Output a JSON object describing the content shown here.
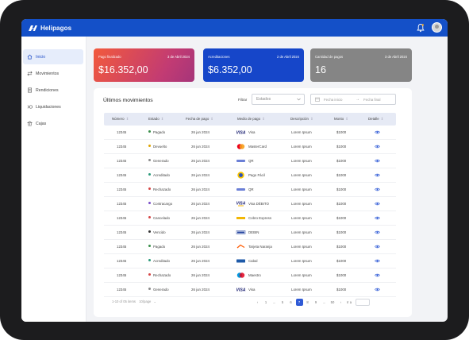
{
  "app": {
    "name": "Helipagos"
  },
  "sidebar": {
    "items": [
      {
        "label": "Inicio",
        "active": true
      },
      {
        "label": "Movimientos"
      },
      {
        "label": "Rendiciones"
      },
      {
        "label": "Liquidaciones"
      },
      {
        "label": "Cajas"
      }
    ]
  },
  "cards": [
    {
      "label": "Pago finalizado",
      "date": "3 de Abril 2024",
      "amount": "$16.352,00"
    },
    {
      "label": "Acreditaciones",
      "date": "2 de Abril 2024",
      "amount": "$6.352,00"
    },
    {
      "label": "Cantidad de pagos",
      "date": "3 de Abril 2024",
      "amount": "16"
    }
  ],
  "movements": {
    "title": "Últimos movimientos",
    "filter_label": "Filtrar",
    "estado_placeholder": "Estados",
    "date_start_placeholder": "Fecha inicio",
    "date_end_placeholder": "Fecha final",
    "columns": [
      "Número",
      "Estado",
      "Fecha de pago",
      "Medio de pago",
      "Descripción",
      "Monto",
      "Detalle"
    ],
    "rows": [
      {
        "numero": "12345",
        "estado": "Pagado",
        "fecha": "26 jun 2024",
        "medio": "Visa",
        "descripcion": "Lorem Ipsum",
        "monto": "$1000"
      },
      {
        "numero": "12345",
        "estado": "Devuelto",
        "fecha": "26 jun 2024",
        "medio": "MasterCard",
        "descripcion": "Lorem Ipsum",
        "monto": "$1000"
      },
      {
        "numero": "12345",
        "estado": "Generado",
        "fecha": "26 jun 2024",
        "medio": "QR",
        "descripcion": "Lorem Ipsum",
        "monto": "$1000"
      },
      {
        "numero": "12345",
        "estado": "Acreditado",
        "fecha": "26 jun 2024",
        "medio": "Pago Fácil",
        "descripcion": "Lorem Ipsum",
        "monto": "$1000"
      },
      {
        "numero": "12345",
        "estado": "Rechazado",
        "fecha": "26 jun 2024",
        "medio": "QR",
        "descripcion": "Lorem Ipsum",
        "monto": "$1000"
      },
      {
        "numero": "12345",
        "estado": "Contracargo",
        "fecha": "26 jun 2024",
        "medio": "Visa DÉBITO",
        "descripcion": "Lorem Ipsum",
        "monto": "$1000"
      },
      {
        "numero": "12345",
        "estado": "Cancelado",
        "fecha": "26 jun 2024",
        "medio": "Cobro Express",
        "descripcion": "Lorem Ipsum",
        "monto": "$1000"
      },
      {
        "numero": "12345",
        "estado": "Vencido",
        "fecha": "26 jun 2024",
        "medio": "DEBIN",
        "descripcion": "Lorem Ipsum",
        "monto": "$1000"
      },
      {
        "numero": "12345",
        "estado": "Pagado",
        "fecha": "26 jun 2024",
        "medio": "Tarjeta Naranja",
        "descripcion": "Lorem Ipsum",
        "monto": "$1000"
      },
      {
        "numero": "12345",
        "estado": "Acreditado",
        "fecha": "26 jun 2024",
        "medio": "Cabal",
        "descripcion": "Lorem Ipsum",
        "monto": "$1000"
      },
      {
        "numero": "12345",
        "estado": "Rechazado",
        "fecha": "26 jun 2024",
        "medio": "Maestro",
        "descripcion": "Lorem Ipsum",
        "monto": "$1000"
      },
      {
        "numero": "12345",
        "estado": "Generado",
        "fecha": "26 jun 2024",
        "medio": "Visa",
        "descripcion": "Lorem Ipsum",
        "monto": "$1000"
      }
    ],
    "status_colors": {
      "Pagado": "#3a8f4a",
      "Devuelto": "#e0a400",
      "Generado": "#8a8a8a",
      "Acreditado": "#2b9a7a",
      "Rechazado": "#d64545",
      "Contracargo": "#7a4fc9",
      "Cancelado": "#d64545",
      "Vencido": "#333333"
    }
  },
  "pagination": {
    "summary": "1-10 of 05 items",
    "page_size": "10/page",
    "pages": [
      "1",
      "...",
      "5",
      "6",
      "7",
      "8",
      "9",
      "...",
      "50"
    ],
    "active_page": "7",
    "goto_label": "Ir a"
  }
}
